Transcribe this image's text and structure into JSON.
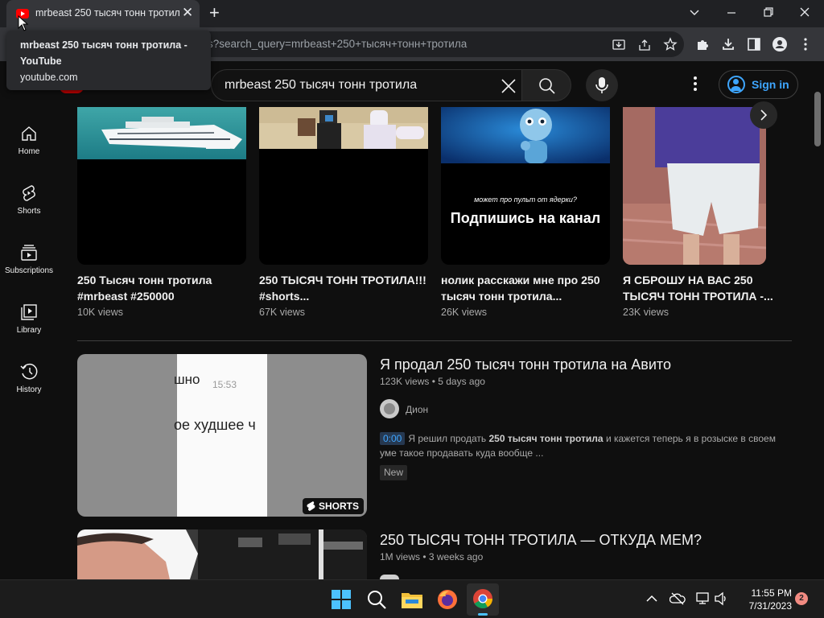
{
  "browser": {
    "tab_title": "mrbeast 250 тысяч тонн тротила",
    "tab_close": "✕",
    "new_tab": "+",
    "url_text": "s?search_query=mrbeast+250+тысяч+тонн+тротила",
    "tooltip": {
      "title": "mrbeast 250 тысяч тонн тротила - YouTube",
      "domain": "youtube.com"
    }
  },
  "header": {
    "search_query": "mrbeast 250 тысяч тонн тротила",
    "signin_label": "Sign in"
  },
  "sidebar": {
    "items": [
      {
        "label": "Home",
        "icon": "home-icon"
      },
      {
        "label": "Shorts",
        "icon": "shorts-icon"
      },
      {
        "label": "Subscriptions",
        "icon": "subscriptions-icon"
      },
      {
        "label": "Library",
        "icon": "library-icon"
      },
      {
        "label": "History",
        "icon": "history-icon"
      }
    ]
  },
  "shorts": [
    {
      "title": "250 Тысяч тонн тротила #mrbeast #250000",
      "views": "10K views"
    },
    {
      "title": "250 ТЫСЯЧ ТОНН ТРОТИЛА!!! #shorts...",
      "views": "67K views"
    },
    {
      "title": "нолик расскажи мне про 250 тысяч тонн тротила...",
      "views": "26K views",
      "overlay_small": "может про пульт от ядерки?",
      "overlay_big": "Подпишись на канал"
    },
    {
      "title": "Я СБРОШУ НА ВАС 250 ТЫСЯЧ ТОНН ТРОТИЛА -...",
      "views": "23K views"
    }
  ],
  "videos": [
    {
      "title": "Я продал 250 тысяч тонн тротила на Авито",
      "meta": "123K views • 5 days ago",
      "channel": "Дион",
      "timestamp": "0:00",
      "desc_before": "Я решил продать",
      "desc_bold": "250 тысяч тонн тротила",
      "desc_after": "и кажется теперь я в розыске в своем уме такое продавать куда вообще ...",
      "badge": "New",
      "shorts_badge": "SHORTS",
      "thumb_text_1": "шно",
      "thumb_time": "15:53",
      "thumb_text_2": "ое худшее ч"
    },
    {
      "title": "250 ТЫСЯЧ ТОНН ТРОТИЛА — ОТКУДА МЕМ?",
      "meta": "1M views • 3 weeks ago"
    }
  ],
  "taskbar": {
    "time": "11:55 PM",
    "date": "7/31/2023",
    "notification_count": "2"
  },
  "colors": {
    "bg": "#0f0f0f",
    "link_blue": "#3ea6ff",
    "yt_red": "#ff0000"
  }
}
